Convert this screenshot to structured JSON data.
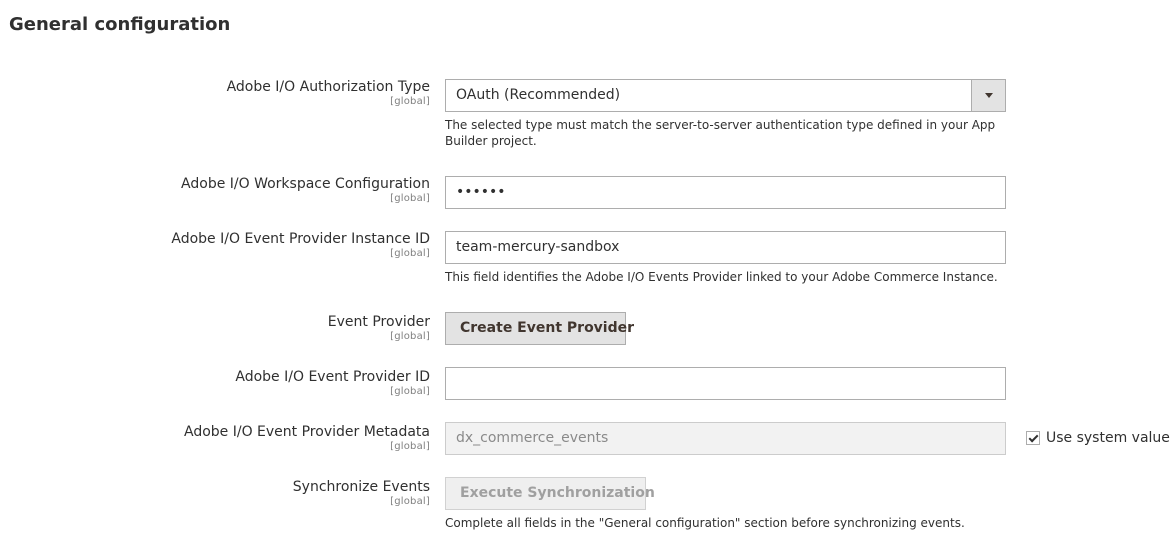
{
  "section": {
    "title": "General configuration"
  },
  "fields": {
    "auth_type": {
      "label": "Adobe I/O Authorization Type",
      "scope": "[global]",
      "value": "OAuth (Recommended)",
      "note": "The selected type must match the server-to-server authentication type defined in your App Builder project."
    },
    "workspace": {
      "label": "Adobe I/O Workspace Configuration",
      "scope": "[global]",
      "value": "••••••"
    },
    "instance_id": {
      "label": "Adobe I/O Event Provider Instance ID",
      "scope": "[global]",
      "value": "team-mercury-sandbox",
      "note": "This field identifies the Adobe I/O Events Provider linked to your Adobe Commerce Instance."
    },
    "event_provider": {
      "label": "Event Provider",
      "scope": "[global]",
      "button": "Create Event Provider"
    },
    "provider_id": {
      "label": "Adobe I/O Event Provider ID",
      "scope": "[global]",
      "value": ""
    },
    "metadata": {
      "label": "Adobe I/O Event Provider Metadata",
      "scope": "[global]",
      "value": "dx_commerce_events",
      "system_value_label": "Use system value"
    },
    "sync": {
      "label": "Synchronize Events",
      "scope": "[global]",
      "button": "Execute Synchronization",
      "note": "Complete all fields in the \"General configuration\" section before synchronizing events."
    }
  }
}
